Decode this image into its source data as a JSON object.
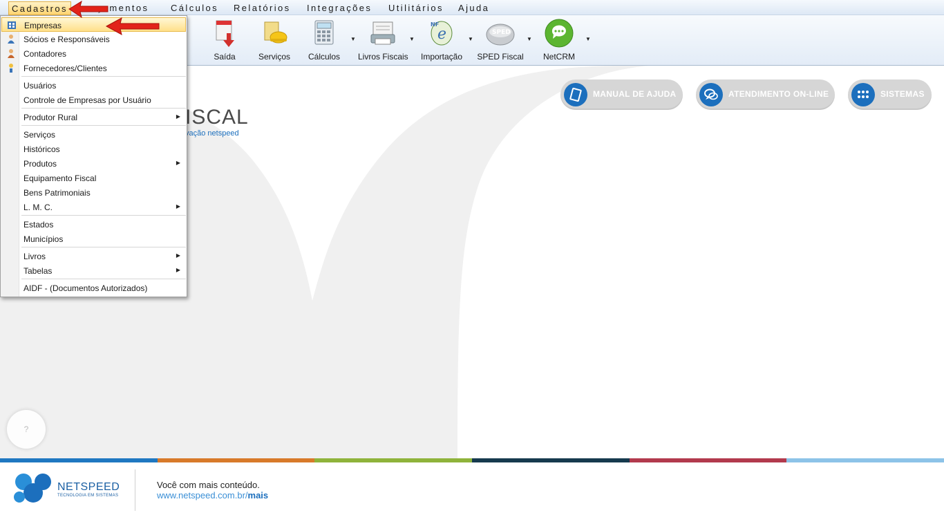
{
  "menubar": {
    "items": [
      {
        "label": "Cadastros",
        "active": true
      },
      {
        "label": "Lançamentos"
      },
      {
        "label": "Cálculos"
      },
      {
        "label": "Relatórios"
      },
      {
        "label": "Integrações"
      },
      {
        "label": "Utilitários"
      },
      {
        "label": "Ajuda"
      }
    ]
  },
  "toolbar": {
    "items": [
      {
        "label": "Saída",
        "icon": "saida-icon"
      },
      {
        "label": "Serviços",
        "icon": "servicos-icon"
      },
      {
        "label": "Cálculos",
        "icon": "calculos-icon",
        "dropdown": true
      },
      {
        "label": "Livros Fiscais",
        "icon": "livros-fiscais-icon",
        "dropdown": true
      },
      {
        "label": "Importação",
        "icon": "importacao-icon",
        "dropdown": true
      },
      {
        "label": "SPED Fiscal",
        "icon": "sped-fiscal-icon",
        "dropdown": true
      },
      {
        "label": "NetCRM",
        "icon": "netcrm-icon",
        "dropdown": true
      }
    ]
  },
  "logo": {
    "text": "ISCAL",
    "sub": "vação netspeed"
  },
  "buttons": {
    "manual": "MANUAL DE AJUDA",
    "atendimento": "ATENDIMENTO ON-LINE",
    "sistemas": "SISTEMAS"
  },
  "help_bubble": "?",
  "dropdown": {
    "items": [
      {
        "label": "Empresas",
        "highlight": true,
        "icon": "empresas-icon"
      },
      {
        "label": "Sócios e Responsáveis",
        "icon": "socios-icon"
      },
      {
        "label": "Contadores",
        "icon": "contadores-icon"
      },
      {
        "label": "Fornecedores/Clientes",
        "icon": "fornecedores-icon"
      },
      {
        "label": "Usuários"
      },
      {
        "label": "Controle de Empresas por Usuário"
      },
      {
        "label": "Produtor Rural",
        "submenu": true
      },
      {
        "label": "Serviços"
      },
      {
        "label": "Históricos"
      },
      {
        "label": "Produtos",
        "submenu": true
      },
      {
        "label": "Equipamento Fiscal"
      },
      {
        "label": "Bens Patrimoniais"
      },
      {
        "label": "L. M. C.",
        "submenu": true
      },
      {
        "label": "Estados"
      },
      {
        "label": "Municípios"
      },
      {
        "label": "Livros",
        "submenu": true
      },
      {
        "label": "Tabelas",
        "submenu": true
      },
      {
        "label": "AIDF - (Documentos Autorizados)"
      }
    ]
  },
  "footer": {
    "brand": "NETSPEED",
    "tagline": "TECNOLOGIA EM SISTEMAS",
    "message": "Você com mais conteúdo.",
    "url": "www.netspeed.com.br/",
    "url_bold": "mais"
  },
  "colors": {
    "strip": [
      "#1f78c1",
      "#d87a2a",
      "#8fb33b",
      "#163a4e",
      "#b23a4d",
      "#8dc3e8"
    ],
    "accent": "#1c6fbd"
  }
}
